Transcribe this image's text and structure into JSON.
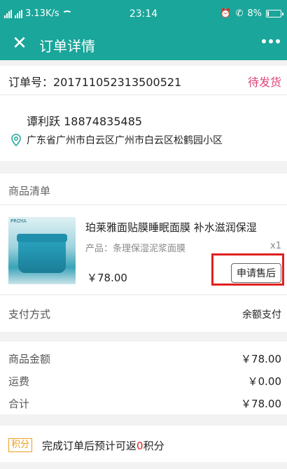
{
  "status_bar": {
    "network": "3.13K/s",
    "time": "23:14",
    "battery": "8%"
  },
  "nav": {
    "title": "订单详情"
  },
  "order": {
    "number": "订单号：201711052313500521",
    "status": "待发货"
  },
  "address": {
    "contact": "谭利跃 18874835485",
    "line": "广东省广州市白云区广州市白云区松鹤园小区"
  },
  "goods": {
    "header": "商品清单",
    "item": {
      "name": "珀莱雅面贴膜睡眠面膜 补水滋润保湿",
      "spec": "产品：条理保湿泥浆面膜",
      "qty": "x1",
      "price": "￥78.00",
      "image_brand": "PROYA",
      "after_sale_label": "申请售后"
    }
  },
  "payment": {
    "label": "支付方式",
    "value": "余额支付"
  },
  "amounts": [
    {
      "label": "商品金额",
      "value": "￥78.00"
    },
    {
      "label": "运费",
      "value": "￥0.00"
    },
    {
      "label": "合计",
      "value": "￥78.00"
    }
  ],
  "points": {
    "tag": "积分",
    "text_before": "完成订单后预计可返",
    "value": "0",
    "text_after": "积分"
  },
  "colors": {
    "primary": "#1aa69a",
    "status": "#e0447a",
    "highlight": "#e02020",
    "points": "#e8a020"
  }
}
